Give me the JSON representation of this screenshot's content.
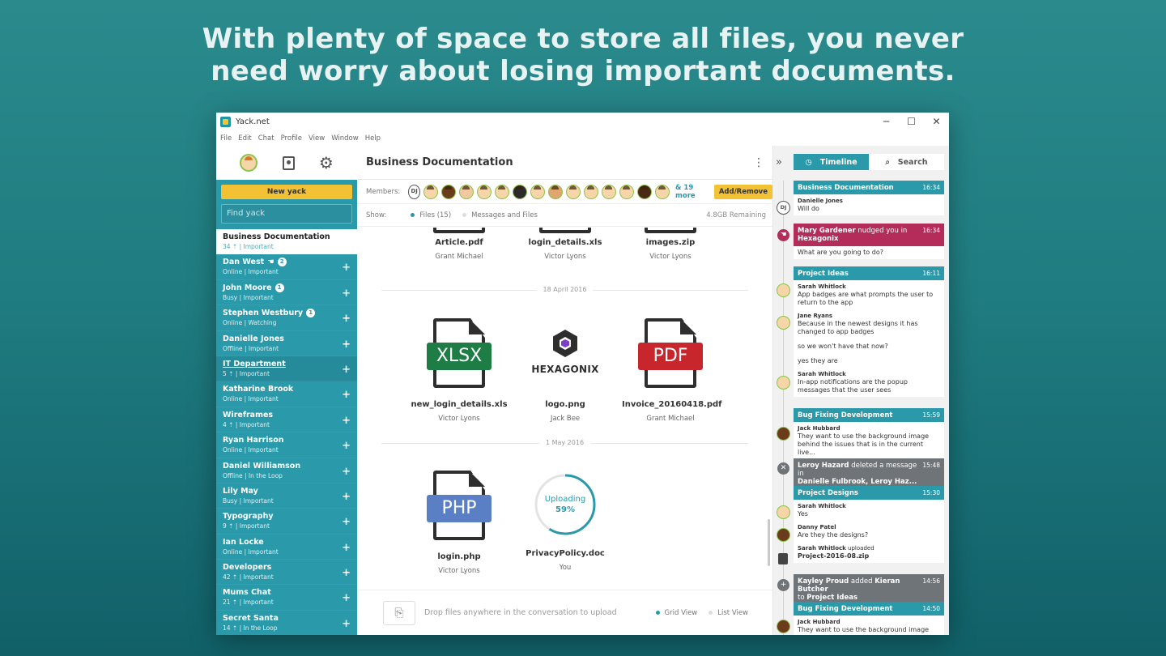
{
  "headline": {
    "line1": "With plenty of space to store all files, you never",
    "line2": "need worry about losing important documents."
  },
  "window": {
    "title": "Yack.net",
    "controls": {
      "minimize": "─",
      "maximize": "☐",
      "close": "✕"
    },
    "menu": [
      "File",
      "Edit",
      "Chat",
      "Profile",
      "View",
      "Window",
      "Help"
    ]
  },
  "sidebar": {
    "new_yack": "New yack",
    "find_placeholder": "Find yack",
    "chats": [
      {
        "name": "Business Documentation",
        "sub": "34 ⇡ | Important",
        "badge": "",
        "active": true
      },
      {
        "name": "Dan West",
        "sub": "Online | Important",
        "badge": "2",
        "hand": true
      },
      {
        "name": "John Moore",
        "sub": "Busy | Important",
        "badge": "1"
      },
      {
        "name": "Stephen Westbury",
        "sub": "Online | Watching",
        "badge": "1"
      },
      {
        "name": "Danielle Jones",
        "sub": "Offline | Important",
        "badge": ""
      },
      {
        "name": "IT Department",
        "sub": "5 ⇡ | Important",
        "badge": "",
        "hover": true
      },
      {
        "name": "Katharine Brook",
        "sub": "Online | Important",
        "badge": ""
      },
      {
        "name": "Wireframes",
        "sub": "4 ⇡ | Important",
        "badge": ""
      },
      {
        "name": "Ryan Harrison",
        "sub": "Online | Important",
        "badge": ""
      },
      {
        "name": "Daniel Williamson",
        "sub": "Offline | In the Loop",
        "badge": ""
      },
      {
        "name": "Lily May",
        "sub": "Busy | Important",
        "badge": ""
      },
      {
        "name": "Typography",
        "sub": "9 ⇡ | Important",
        "badge": ""
      },
      {
        "name": "Ian Locke",
        "sub": "Online | Important",
        "badge": ""
      },
      {
        "name": "Developers",
        "sub": "42 ⇡ | Important",
        "badge": ""
      },
      {
        "name": "Mums Chat",
        "sub": "21 ⇡ | Important",
        "badge": ""
      },
      {
        "name": "Secret Santa",
        "sub": "14 ⇡ | In the Loop",
        "badge": ""
      }
    ],
    "plus": "+"
  },
  "main": {
    "title": "Business Documentation",
    "members_label": "Members:",
    "member_initials": "DJ",
    "more": "& 19 more",
    "add_remove": "Add/Remove",
    "show_label": "Show:",
    "filter_files": "Files (15)",
    "filter_all": "Messages and Files",
    "storage": "4.8GB Remaining",
    "date1": "18 April 2016",
    "date2": "1 May 2016",
    "files_top": [
      {
        "name": "Article.pdf",
        "owner": "Grant Michael"
      },
      {
        "name": "login_details.xls",
        "owner": "Victor Lyons"
      },
      {
        "name": "images.zip",
        "owner": "Victor Lyons"
      }
    ],
    "files_mid": [
      {
        "name": "new_login_details.xls",
        "owner": "Victor Lyons",
        "tag": "XLSX",
        "color": "#1e7d45"
      },
      {
        "name": "logo.png",
        "owner": "Jack Bee",
        "logo_word": "HEXAGONIX"
      },
      {
        "name": "Invoice_20160418.pdf",
        "owner": "Grant Michael",
        "tag": "PDF",
        "color": "#c8262d"
      }
    ],
    "files_bottom": [
      {
        "name": "login.php",
        "owner": "Victor Lyons",
        "tag": "PHP",
        "color": "#5b7fc5"
      },
      {
        "name": "PrivacyPolicy.doc",
        "owner": "You",
        "upload_label": "Uploading",
        "upload_pct": "59%",
        "progress": 0.59
      }
    ],
    "drop_text": "Drop files anywhere in the conversation to upload",
    "grid_view": "Grid View",
    "list_view": "List View",
    "accent": "#2a9aab"
  },
  "right": {
    "tab_timeline": "Timeline",
    "tab_search": "Search",
    "events": [
      {
        "head": "Business Documentation",
        "time": "16:34",
        "who": "Danielle Jones",
        "text": "Will do"
      },
      {
        "head_actor": "Mary Gardener",
        "head_action": " nudged you in ",
        "head_target": "Hexagonix",
        "time": "16:34",
        "text": "What are you going to do?"
      },
      {
        "head": "Project Ideas",
        "time": "16:11",
        "msgs": [
          {
            "who": "Sarah Whitlock",
            "text": "App badges are what prompts the user to return to the app"
          },
          {
            "who": "Jane Ryans",
            "text": "Because in the newest designs it has changed to app badges"
          },
          {
            "who": "",
            "text": "so we won't have that now?"
          },
          {
            "who": "",
            "text": "yes they are"
          },
          {
            "who": "Sarah Whitlock",
            "text": "In-app notifications are the popup messages that the user sees"
          }
        ]
      },
      {
        "head": "Bug Fixing Development",
        "time": "15:59",
        "who": "Jack Hubbard",
        "text": "They want to use the background image behind the issues that is in the current live..."
      },
      {
        "head_actor": "Leroy Hazard",
        "head_action": " deleted a message in ",
        "head_target": "Danielle Fulbrook, Leroy Haz...",
        "time": "15:48"
      },
      {
        "head": "Project Designs",
        "time": "15:30",
        "msgs": [
          {
            "who": "Sarah Whitlock",
            "text": "Yes"
          },
          {
            "who": "Danny Patel",
            "text": "Are they the designs?"
          },
          {
            "who": "Sarah Whitlock",
            "who_suffix": " uploaded",
            "text": "Project-2016-08.zip"
          }
        ]
      },
      {
        "head_actor": "Kayley Proud",
        "head_action": " added ",
        "head_target": "Kieran Butcher",
        "head_tail": " to ",
        "head_target2": "Project Ideas",
        "time": "14:56"
      },
      {
        "head": "Bug Fixing Development",
        "time": "14:50",
        "who": "Jack Hubbard",
        "text": "They want to use the background image"
      }
    ]
  }
}
